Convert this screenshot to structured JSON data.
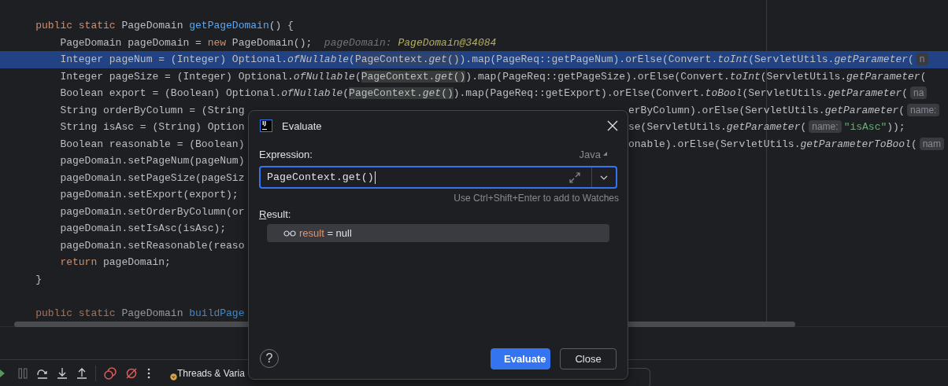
{
  "editor": {
    "lines": [
      {
        "current": false,
        "tokens": [
          {
            "text": "    public static ",
            "kind": "k"
          },
          {
            "text": "PageDomain ",
            "kind": "p"
          },
          {
            "text": "getPageDomain",
            "kind": "m"
          },
          {
            "text": "() {",
            "kind": "p"
          }
        ]
      },
      {
        "current": false,
        "tokens": [
          {
            "text": "        PageDomain pageDomain = ",
            "kind": "p"
          },
          {
            "text": "new",
            "kind": "k"
          },
          {
            "text": " PageDomain();",
            "kind": "p"
          },
          {
            "text": "pageDomain: ",
            "kind": "hl"
          },
          {
            "text": "PageDomain@34084",
            "kind": "hv"
          }
        ]
      },
      {
        "current": true,
        "tokens": [
          {
            "text": "        Integer pageNum = (Integer) Optional.",
            "kind": "p"
          },
          {
            "text": "ofNullable",
            "kind": "i"
          },
          {
            "text": "(",
            "kind": "p"
          },
          {
            "text": "PageContext.",
            "kind": "o"
          },
          {
            "text": "get",
            "kind": "oi"
          },
          {
            "text": "()",
            "kind": "o"
          },
          {
            "text": ").map(PageReq::getPageNum).orElse(Convert.",
            "kind": "p"
          },
          {
            "text": "toInt",
            "kind": "i"
          },
          {
            "text": "(ServletUtils.",
            "kind": "p"
          },
          {
            "text": "getParameter",
            "kind": "i"
          },
          {
            "text": "(",
            "kind": "p"
          },
          {
            "text": "n",
            "kind": "ph"
          }
        ]
      },
      {
        "current": false,
        "tokens": [
          {
            "text": "        Integer pageSize = (Integer) Optional.",
            "kind": "p"
          },
          {
            "text": "ofNullable",
            "kind": "i"
          },
          {
            "text": "(",
            "kind": "p"
          },
          {
            "text": "PageContext.",
            "kind": "o"
          },
          {
            "text": "get",
            "kind": "oi"
          },
          {
            "text": "()",
            "kind": "o"
          },
          {
            "text": ").map(PageReq::getPageSize).orElse(Convert.",
            "kind": "p"
          },
          {
            "text": "toInt",
            "kind": "i"
          },
          {
            "text": "(ServletUtils.",
            "kind": "p"
          },
          {
            "text": "getParameter",
            "kind": "i"
          },
          {
            "text": "(",
            "kind": "p"
          }
        ]
      },
      {
        "current": false,
        "tokens": [
          {
            "text": "        Boolean export = (Boolean) Optional.",
            "kind": "p"
          },
          {
            "text": "ofNullable",
            "kind": "i"
          },
          {
            "text": "(",
            "kind": "p"
          },
          {
            "text": "PageContext.",
            "kind": "o"
          },
          {
            "text": "get",
            "kind": "oi"
          },
          {
            "text": "()",
            "kind": "o"
          },
          {
            "text": ").map(PageReq::getExport).orElse(Convert.",
            "kind": "p"
          },
          {
            "text": "toBool",
            "kind": "i"
          },
          {
            "text": "(ServletUtils.",
            "kind": "p"
          },
          {
            "text": "getParameter",
            "kind": "i"
          },
          {
            "text": "(",
            "kind": "p"
          },
          {
            "text": "na",
            "kind": "ph"
          }
        ]
      },
      {
        "current": false,
        "tokens": [
          {
            "text": "        String orderByColumn = (String",
            "kind": "p"
          }
        ],
        "after": [
          {
            "text": "erByColumn).orElse(ServletUtils.",
            "kind": "p"
          },
          {
            "text": "getParameter",
            "kind": "i"
          },
          {
            "text": "(",
            "kind": "p"
          },
          {
            "text": "name:",
            "kind": "ph"
          }
        ]
      },
      {
        "current": false,
        "tokens": [
          {
            "text": "        String isAsc = (String) Option",
            "kind": "p"
          }
        ],
        "after": [
          {
            "text": "se(ServletUtils.",
            "kind": "p"
          },
          {
            "text": "getParameter",
            "kind": "i"
          },
          {
            "text": "(",
            "kind": "p"
          },
          {
            "text": "name:",
            "kind": "ph"
          },
          {
            "text": "\"isAsc\"",
            "kind": "s"
          },
          {
            "text": "));",
            "kind": "p"
          }
        ]
      },
      {
        "current": false,
        "tokens": [
          {
            "text": "        Boolean reasonable = (Boolean)",
            "kind": "p"
          }
        ],
        "after": [
          {
            "text": "onable).orElse(ServletUtils.",
            "kind": "p"
          },
          {
            "text": "getParameterToBool",
            "kind": "i"
          },
          {
            "text": "(",
            "kind": "p"
          },
          {
            "text": "nam",
            "kind": "ph"
          }
        ]
      },
      {
        "current": false,
        "tokens": [
          {
            "text": "        pageDomain.setPageNum(pageNum)",
            "kind": "p"
          }
        ]
      },
      {
        "current": false,
        "tokens": [
          {
            "text": "        pageDomain.setPageSize(pageSiz",
            "kind": "p"
          }
        ]
      },
      {
        "current": false,
        "tokens": [
          {
            "text": "        pageDomain.setExport(export);",
            "kind": "p"
          }
        ]
      },
      {
        "current": false,
        "tokens": [
          {
            "text": "        pageDomain.setOrderByColumn(or",
            "kind": "p"
          }
        ]
      },
      {
        "current": false,
        "tokens": [
          {
            "text": "        pageDomain.setIsAsc(isAsc);",
            "kind": "p"
          }
        ]
      },
      {
        "current": false,
        "tokens": [
          {
            "text": "        pageDomain.setReasonable(reaso",
            "kind": "p"
          }
        ]
      },
      {
        "current": false,
        "tokens": [
          {
            "text": "        return",
            "kind": "k"
          },
          {
            "text": " pageDomain;",
            "kind": "p"
          }
        ]
      },
      {
        "current": false,
        "tokens": [
          {
            "text": "    }",
            "kind": "p"
          }
        ]
      }
    ],
    "next_method_line": [
      {
        "text": "    public static",
        "kind": "k"
      },
      {
        "text": " PageDomain ",
        "kind": "p"
      },
      {
        "text": "buildPage",
        "kind": "m"
      }
    ]
  },
  "dialog": {
    "logo_text": "IJ",
    "title": "Evaluate",
    "expression_label": "Expression:",
    "language": "Java",
    "expression": "PageContext.get()",
    "hint": "Use Ctrl+Shift+Enter to add to Watches",
    "result_label": "Result:",
    "result": {
      "name": "result",
      "separator": " = ",
      "value": "null"
    },
    "help_button": "?",
    "buttons": [
      {
        "label": "Evaluate",
        "primary": true
      },
      {
        "label": "Close",
        "primary": false
      }
    ]
  },
  "debug_toolbar": {
    "tab": "Threads & Varia"
  }
}
